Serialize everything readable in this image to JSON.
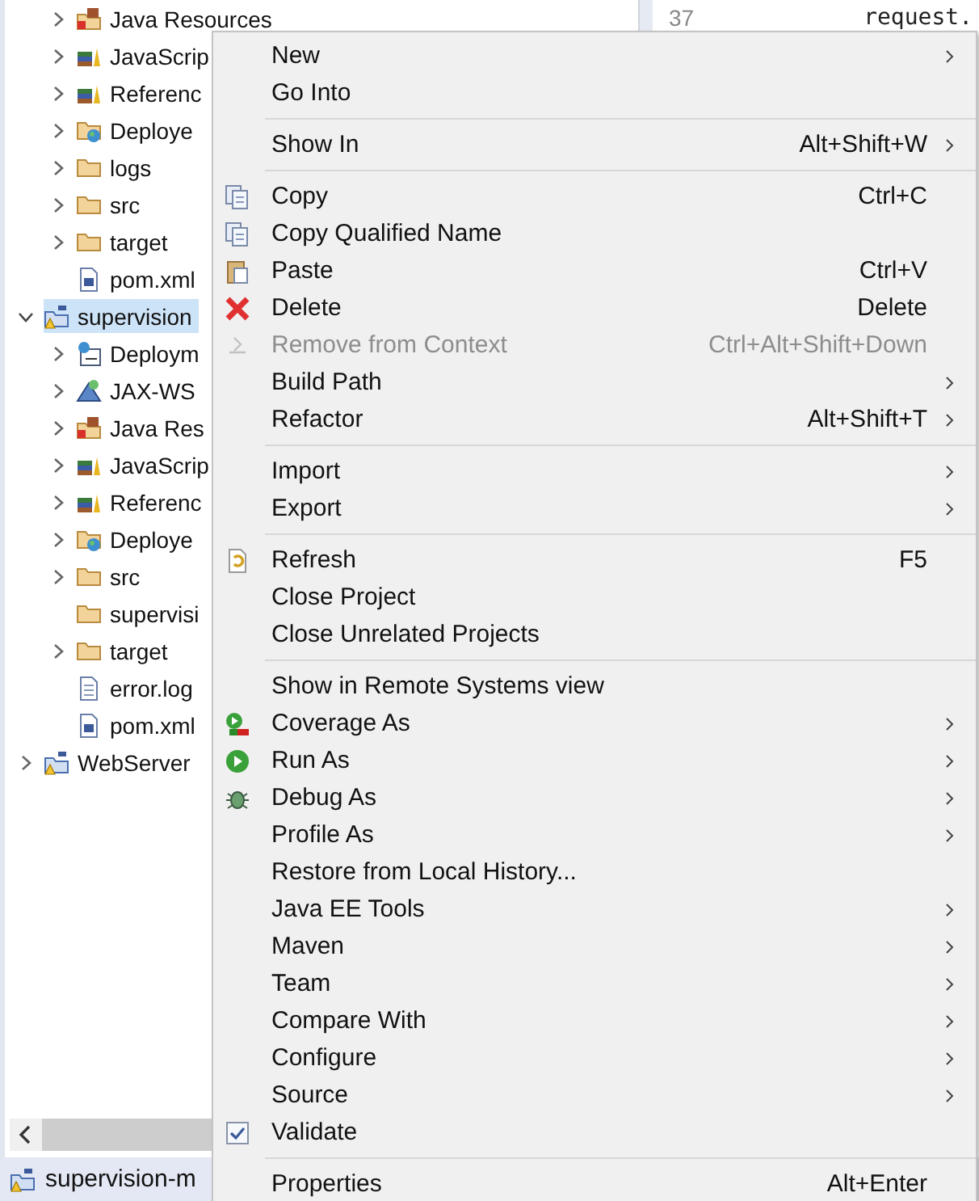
{
  "tree": {
    "continued_children": [
      {
        "label": "Java Resources",
        "expanded": false,
        "selected": false
      },
      {
        "label": "JavaScrip",
        "expanded": false,
        "selected": false
      },
      {
        "label": "Referenc",
        "expanded": false,
        "selected": false
      },
      {
        "label": "Deploye",
        "expanded": false,
        "selected": false
      },
      {
        "label": "logs",
        "expanded": false,
        "selected": false
      },
      {
        "label": "src",
        "expanded": false,
        "selected": false
      },
      {
        "label": "target",
        "expanded": false,
        "selected": false
      },
      {
        "label": "pom.xml",
        "selected": false
      }
    ],
    "items": [
      {
        "label": "supervision",
        "expanded": true,
        "selected": true,
        "children": [
          {
            "label": "Deploym",
            "expanded": false,
            "selected": false
          },
          {
            "label": "JAX-WS",
            "expanded": false,
            "selected": false
          },
          {
            "label": "Java Res",
            "expanded": false,
            "selected": false
          },
          {
            "label": "JavaScrip",
            "expanded": false,
            "selected": false
          },
          {
            "label": "Referenc",
            "expanded": false,
            "selected": false
          },
          {
            "label": "Deploye",
            "expanded": false,
            "selected": false
          },
          {
            "label": "src",
            "expanded": false,
            "selected": false
          },
          {
            "label": "supervisi",
            "selected": false
          },
          {
            "label": "target",
            "expanded": false,
            "selected": false
          },
          {
            "label": "error.log",
            "selected": false
          },
          {
            "label": "pom.xml",
            "selected": false
          }
        ]
      },
      {
        "label": "WebServer",
        "expanded": false,
        "selected": false
      }
    ]
  },
  "editor": {
    "line_number": "37",
    "code": "request."
  },
  "status_bar": {
    "project": "supervision-m"
  },
  "context_menu": {
    "groups": [
      [
        {
          "kind": "command",
          "label": "New",
          "submenu": true,
          "disabled": false
        },
        {
          "kind": "command",
          "label": "Go Into",
          "submenu": false,
          "disabled": false
        }
      ],
      [
        {
          "kind": "command",
          "label": "Show In",
          "shortcut": "Alt+Shift+W",
          "submenu": true,
          "disabled": false
        }
      ],
      [
        {
          "kind": "command",
          "label": "Copy",
          "shortcut": "Ctrl+C",
          "submenu": false,
          "disabled": false
        },
        {
          "kind": "command",
          "label": "Copy Qualified Name",
          "submenu": false,
          "disabled": false
        },
        {
          "kind": "command",
          "label": "Paste",
          "shortcut": "Ctrl+V",
          "submenu": false,
          "disabled": false
        },
        {
          "kind": "command",
          "label": "Delete",
          "shortcut": "Delete",
          "submenu": false,
          "disabled": false
        },
        {
          "kind": "command",
          "label": "Remove from Context",
          "shortcut": "Ctrl+Alt+Shift+Down",
          "submenu": false,
          "disabled": true
        },
        {
          "kind": "command",
          "label": "Build Path",
          "submenu": true,
          "disabled": false
        },
        {
          "kind": "command",
          "label": "Refactor",
          "shortcut": "Alt+Shift+T",
          "submenu": true,
          "disabled": false
        }
      ],
      [
        {
          "kind": "command",
          "label": "Import",
          "submenu": true,
          "disabled": false
        },
        {
          "kind": "command",
          "label": "Export",
          "submenu": true,
          "disabled": false
        }
      ],
      [
        {
          "kind": "command",
          "label": "Refresh",
          "shortcut": "F5",
          "submenu": false,
          "disabled": false
        },
        {
          "kind": "command",
          "label": "Close Project",
          "submenu": false,
          "disabled": false
        },
        {
          "kind": "command",
          "label": "Close Unrelated Projects",
          "submenu": false,
          "disabled": false
        }
      ],
      [
        {
          "kind": "command",
          "label": "Show in Remote Systems view",
          "submenu": false,
          "disabled": false
        },
        {
          "kind": "command",
          "label": "Coverage As",
          "submenu": true,
          "disabled": false
        },
        {
          "kind": "command",
          "label": "Run As",
          "submenu": true,
          "disabled": false
        },
        {
          "kind": "command",
          "label": "Debug As",
          "submenu": true,
          "disabled": false
        },
        {
          "kind": "command",
          "label": "Profile As",
          "submenu": true,
          "disabled": false
        },
        {
          "kind": "command",
          "label": "Restore from Local History...",
          "submenu": false,
          "disabled": false
        },
        {
          "kind": "command",
          "label": "Java EE Tools",
          "submenu": true,
          "disabled": false
        },
        {
          "kind": "command",
          "label": "Maven",
          "submenu": true,
          "disabled": false
        },
        {
          "kind": "command",
          "label": "Team",
          "submenu": true,
          "disabled": false
        },
        {
          "kind": "command",
          "label": "Compare With",
          "submenu": true,
          "disabled": false
        },
        {
          "kind": "command",
          "label": "Configure",
          "submenu": true,
          "disabled": false
        },
        {
          "kind": "command",
          "label": "Source",
          "submenu": true,
          "disabled": false
        },
        {
          "kind": "check",
          "label": "Validate",
          "checked": true,
          "submenu": false,
          "disabled": false
        }
      ],
      [
        {
          "kind": "command",
          "label": "Properties",
          "shortcut": "Alt+Enter",
          "submenu": false,
          "disabled": false
        }
      ]
    ]
  }
}
